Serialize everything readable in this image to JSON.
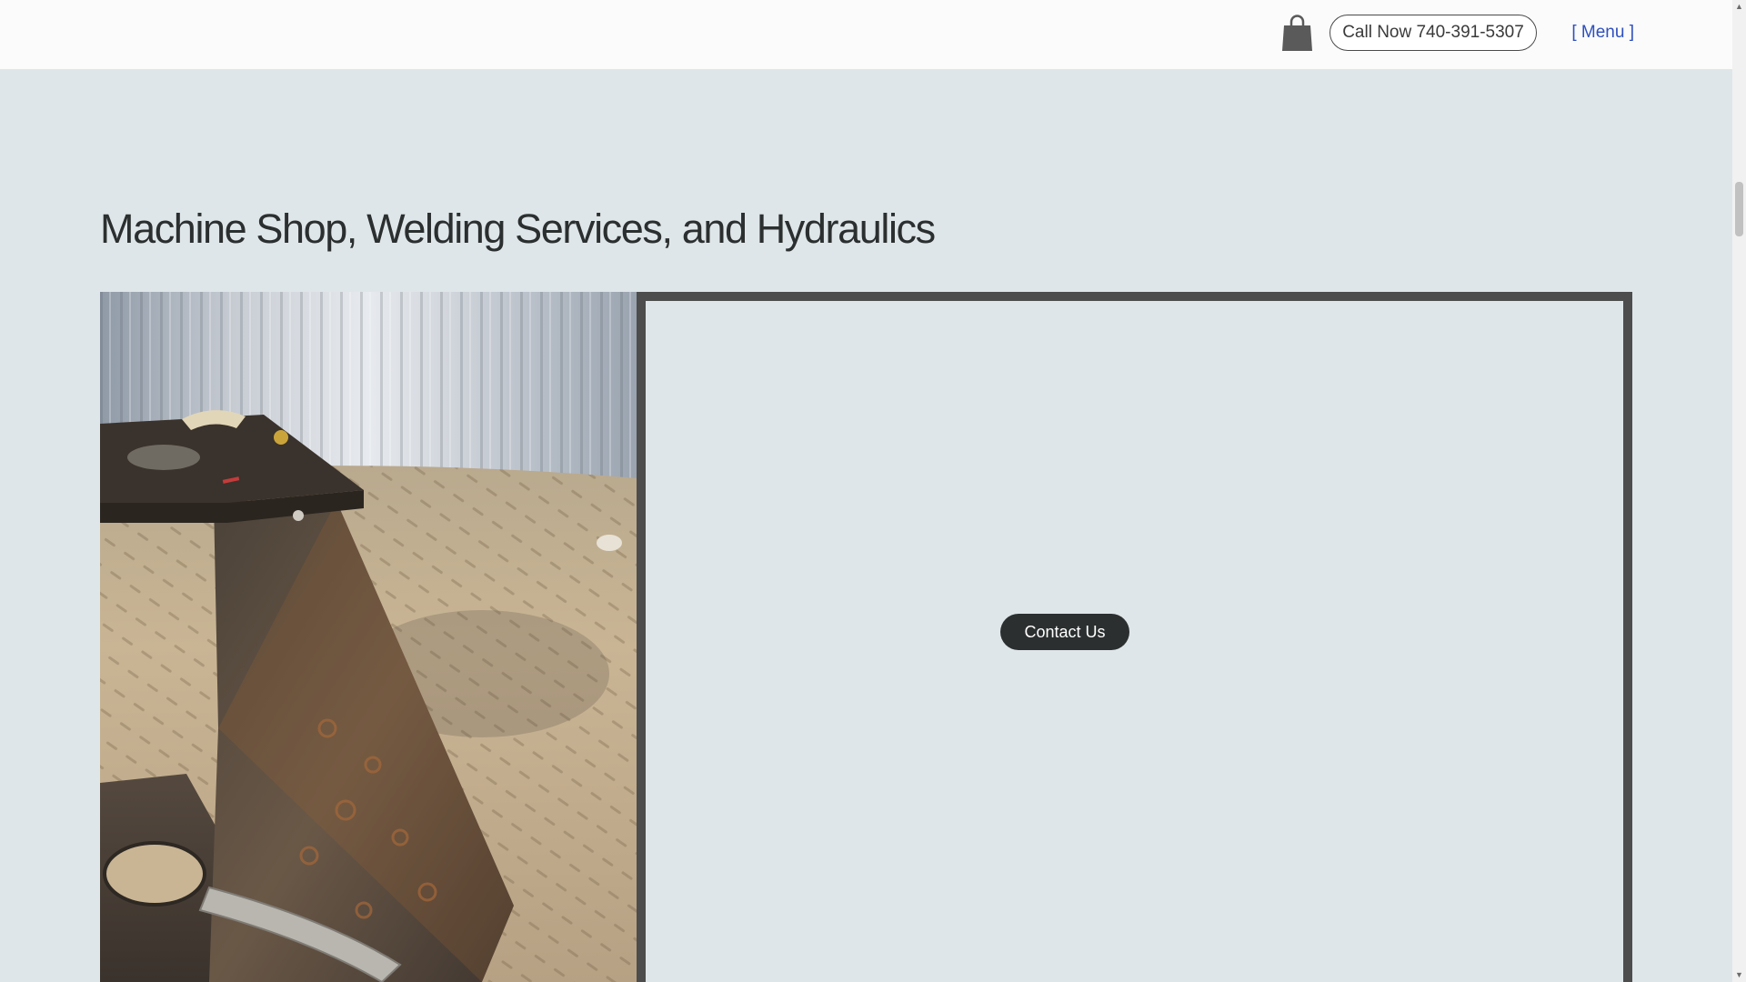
{
  "header": {
    "cart_icon": "shopping-bag-icon",
    "call_label": "Call Now 740-391-5307",
    "menu_label": "[ Menu ]"
  },
  "main": {
    "headline": "Machine Shop, Welding Services, and Hydraulics",
    "contact_label": "Contact Us"
  },
  "colors": {
    "page_bg": "#dfe6e9",
    "header_bg": "#fafbfa",
    "panel_frame": "#4c4d4c",
    "headline_text": "#2b2f2f",
    "menu_link": "#2f4fbf",
    "contact_button_bg": "#2b2f2f"
  }
}
